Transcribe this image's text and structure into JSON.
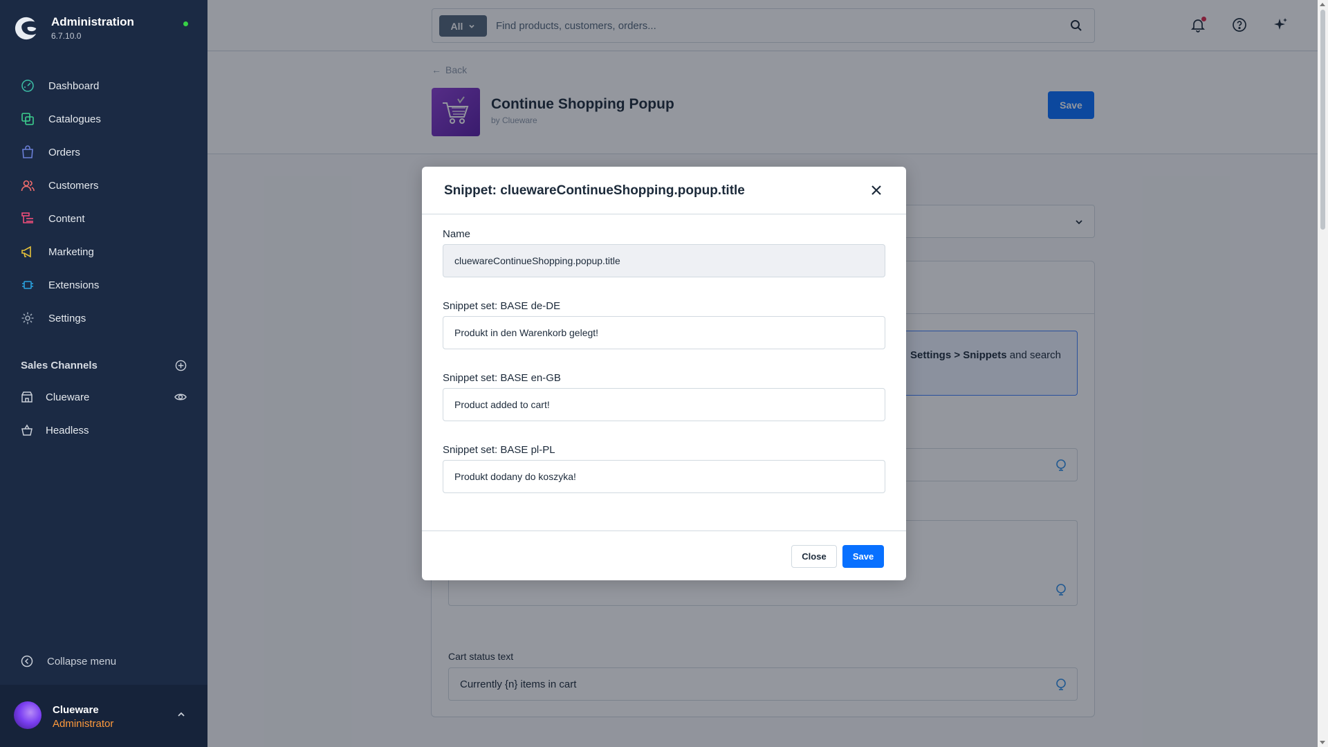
{
  "app": {
    "title": "Administration",
    "version": "6.7.10.0"
  },
  "sidebar": {
    "items": [
      {
        "label": "Dashboard",
        "icon": "dashboard-icon"
      },
      {
        "label": "Catalogues",
        "icon": "catalogues-icon"
      },
      {
        "label": "Orders",
        "icon": "orders-icon"
      },
      {
        "label": "Customers",
        "icon": "customers-icon"
      },
      {
        "label": "Content",
        "icon": "content-icon"
      },
      {
        "label": "Marketing",
        "icon": "marketing-icon"
      },
      {
        "label": "Extensions",
        "icon": "extensions-icon"
      },
      {
        "label": "Settings",
        "icon": "settings-icon"
      }
    ],
    "sales_channels_title": "Sales Channels",
    "sales_channels": [
      {
        "label": "Clueware"
      },
      {
        "label": "Headless"
      }
    ],
    "collapse_label": "Collapse menu",
    "user": {
      "name": "Clueware",
      "role": "Administrator"
    }
  },
  "search": {
    "scope": "All",
    "placeholder": "Find products, customers, orders..."
  },
  "page": {
    "back_label": "Back",
    "title": "Continue Shopping Popup",
    "by": "by Clueware",
    "save_label": "Save",
    "info_text_bold": "Settings > Snippets",
    "info_text_rest": " and search",
    "cart_status_label": "Cart status text",
    "cart_status_value": "Currently {n} items in cart"
  },
  "modal": {
    "title": "Snippet: cluewareContinueShopping.popup.title",
    "fields": [
      {
        "label": "Name",
        "value": "cluewareContinueShopping.popup.title",
        "disabled": true
      },
      {
        "label": "Snippet set: BASE de-DE",
        "value": "Produkt in den Warenkorb gelegt!"
      },
      {
        "label": "Snippet set: BASE en-GB",
        "value": "Product added to cart!"
      },
      {
        "label": "Snippet set: BASE pl-PL",
        "value": "Produkt dodany do koszyka!"
      }
    ],
    "close_label": "Close",
    "save_label": "Save"
  },
  "colors": {
    "sidebar_bg": "#1b2a44",
    "primary": "#0870ff",
    "user_role": "#ff9a3c",
    "status_online": "#37d046",
    "notification": "#de294c"
  }
}
